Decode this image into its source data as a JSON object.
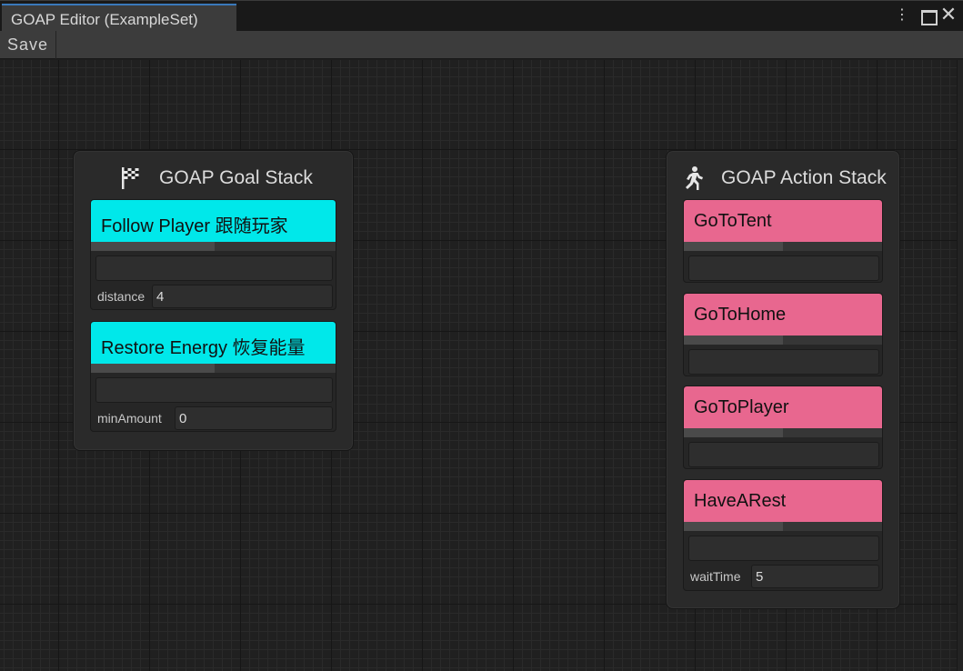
{
  "window": {
    "tab_title": "GOAP Editor (ExampleSet)",
    "controls": {
      "menu_icon": "kebab-menu-icon",
      "maximize_icon": "maximize-icon",
      "close_icon": "close-icon"
    }
  },
  "toolbar": {
    "save_label": "Save"
  },
  "goal_stack": {
    "title": "GOAP Goal Stack",
    "icon": "checkered-flag-icon",
    "accent": "#00e8ea",
    "goals": [
      {
        "label": "Follow Player 跟随玩家",
        "prop_label": "distance",
        "prop_value": "4"
      },
      {
        "label": "Restore Energy 恢复能量",
        "prop_label": "minAmount",
        "prop_value": "0"
      }
    ]
  },
  "action_stack": {
    "title": "GOAP Action Stack",
    "icon": "running-person-icon",
    "accent": "#e8678f",
    "actions": [
      {
        "label": "GoToTent"
      },
      {
        "label": "GoToHome"
      },
      {
        "label": "GoToPlayer"
      },
      {
        "label": "HaveARest",
        "prop_label": "waitTime",
        "prop_value": "5"
      }
    ]
  }
}
